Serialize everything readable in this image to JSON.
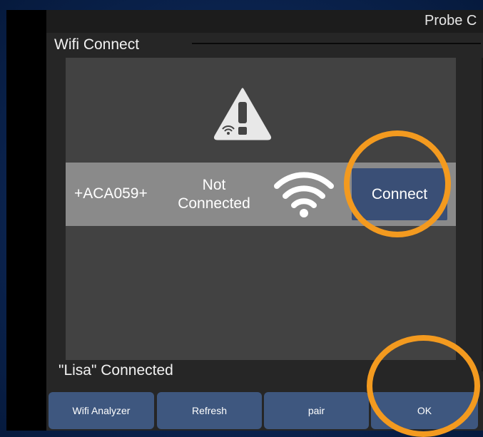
{
  "app": {
    "title": "Probe C"
  },
  "dialog": {
    "title": "Wifi Connect",
    "network": {
      "ssid": "+ACA059+",
      "status": "Not Connected",
      "signal_icon": "wifi-icon",
      "connect_label": "Connect"
    },
    "warning_icon": "warning-icon",
    "connected_status": "\"Lisa\" Connected"
  },
  "buttons": {
    "wifi_analyzer": "Wifi Analyzer",
    "refresh": "Refresh",
    "pair": "pair",
    "ok": "OK"
  },
  "colors": {
    "annotation": "#f39a1f",
    "button": "#3e577f",
    "connect_button": "#3a4f76"
  }
}
